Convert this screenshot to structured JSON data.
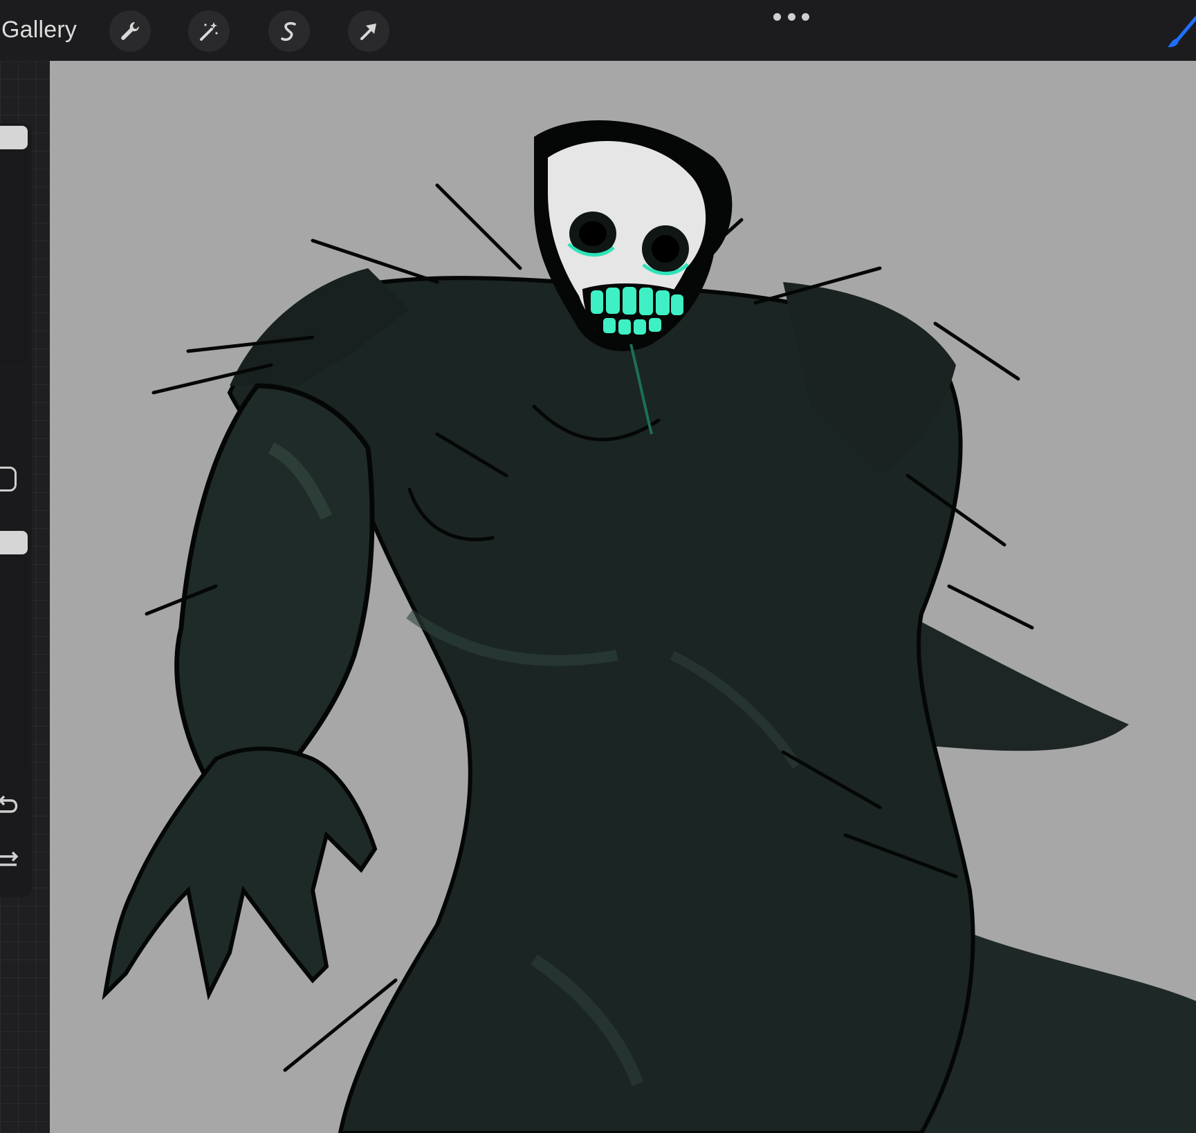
{
  "topbar": {
    "gallery_label": "Gallery",
    "tools": [
      {
        "name": "actions",
        "icon": "wrench-icon"
      },
      {
        "name": "adjustments",
        "icon": "magic-wand-icon"
      },
      {
        "name": "selection",
        "icon": "selection-s-icon"
      },
      {
        "name": "transform",
        "icon": "arrow-cursor-icon"
      }
    ],
    "more_icon": "more-dots-icon",
    "active_tool_icon": "brush-icon",
    "accent_color": "#1f6fff"
  },
  "sidebar": {
    "brush_size_level": 0.0,
    "opacity_level": 0.0,
    "modify_icon": "modify-square-icon",
    "undo_icon": "undo-icon",
    "redo_icon": "redo-icon"
  },
  "canvas": {
    "background_color": "#a7a7a7",
    "artwork": "drawing-canvas"
  }
}
